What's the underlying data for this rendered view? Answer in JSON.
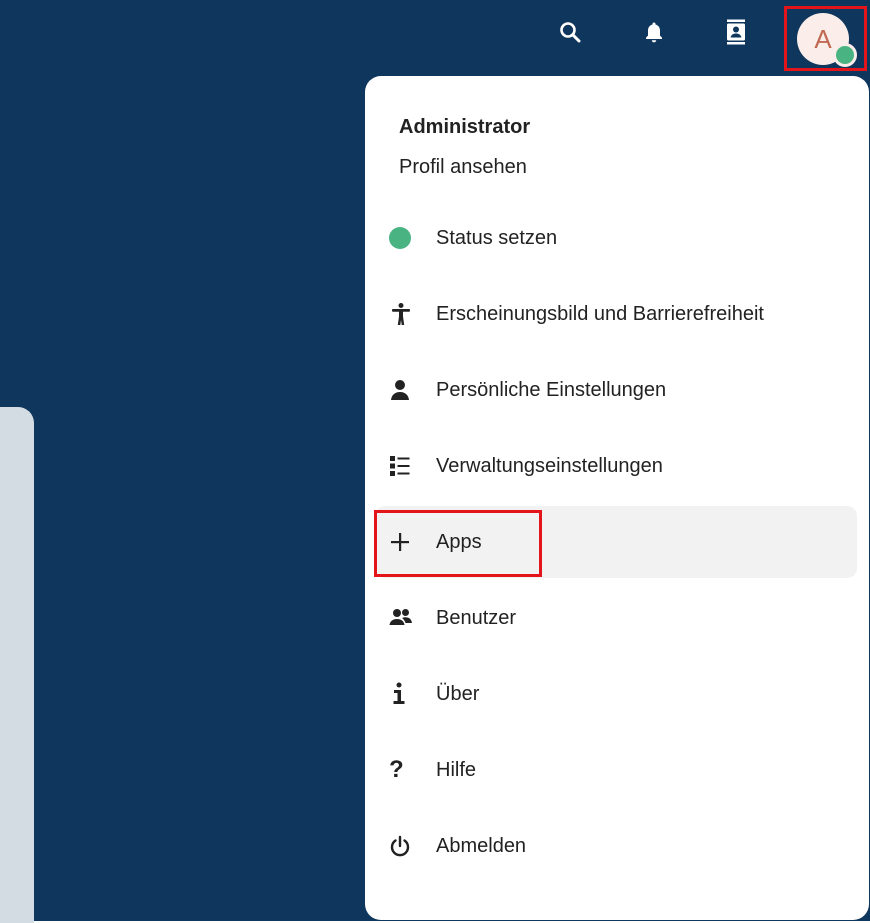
{
  "header": {
    "icons": [
      "search-icon",
      "bell-icon",
      "contacts-icon"
    ],
    "avatar_initial": "A"
  },
  "user_menu": {
    "name": "Administrator",
    "profile_link": "Profil ansehen",
    "items": [
      {
        "label": "Status setzen",
        "icon": "status-dot-icon"
      },
      {
        "label": "Erscheinungsbild und Barrierefreiheit",
        "icon": "accessibility-icon"
      },
      {
        "label": "Persönliche Einstellungen",
        "icon": "user-icon"
      },
      {
        "label": "Verwaltungseinstellungen",
        "icon": "list-settings-icon"
      },
      {
        "label": "Apps",
        "icon": "plus-icon"
      },
      {
        "label": "Benutzer",
        "icon": "users-icon"
      },
      {
        "label": "Über",
        "icon": "info-icon"
      },
      {
        "label": "Hilfe",
        "icon": "help-icon"
      },
      {
        "label": "Abmelden",
        "icon": "power-icon"
      }
    ]
  },
  "colors": {
    "header_bg": "#0f375d",
    "online_status": "#49b382",
    "highlight": "#e3151b"
  }
}
